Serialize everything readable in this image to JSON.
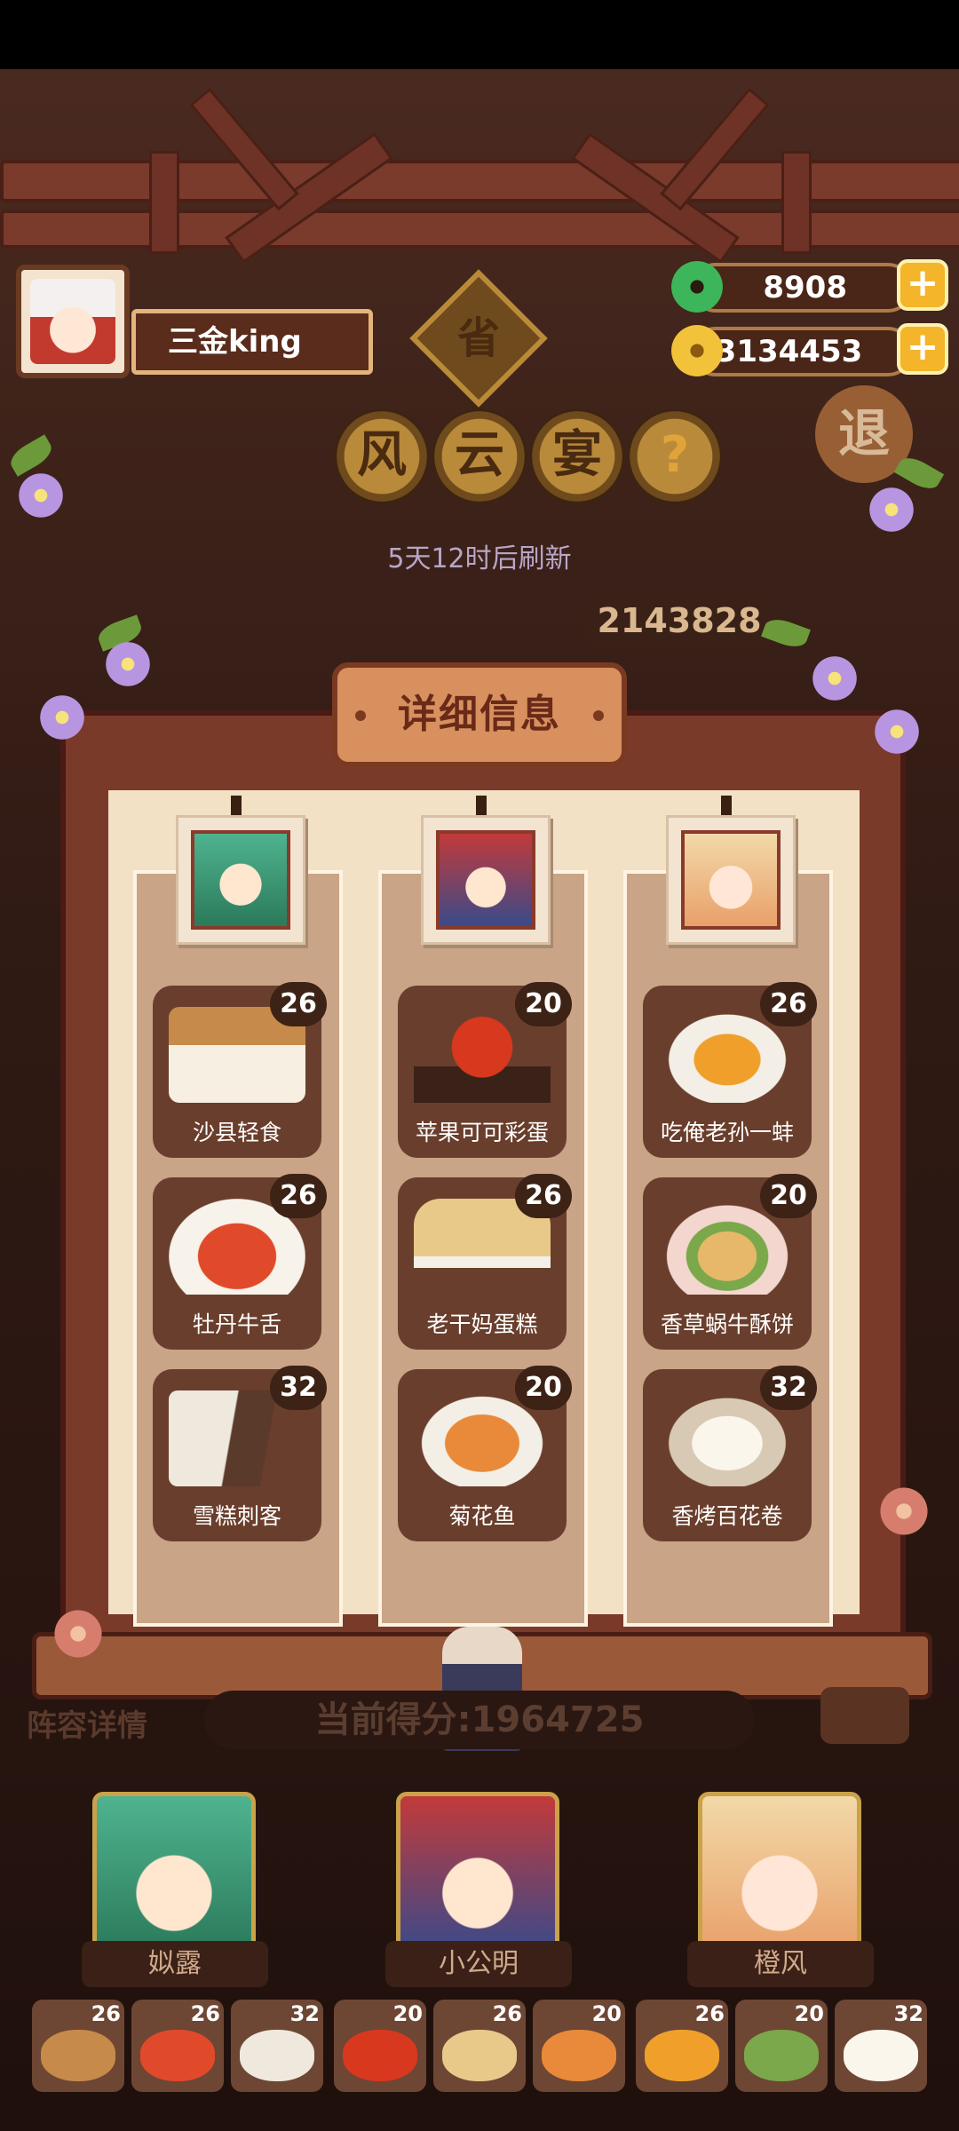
{
  "player": {
    "name": "三金king"
  },
  "currency": {
    "jade": "8908",
    "coins": "33134453"
  },
  "event": {
    "badge": "省",
    "title_chars": [
      "风",
      "云",
      "宴"
    ],
    "help": "?",
    "exit": "退",
    "refresh_text": "5天12时后刷新",
    "score_chip": "2143828"
  },
  "panel": {
    "title": "详细信息",
    "columns": [
      {
        "hero": "姒露",
        "dishes": [
          {
            "name": "沙县轻食",
            "level": "26"
          },
          {
            "name": "牡丹牛舌",
            "level": "26"
          },
          {
            "name": "雪糕刺客",
            "level": "32"
          }
        ]
      },
      {
        "hero": "小公明",
        "dishes": [
          {
            "name": "苹果可可彩蛋",
            "level": "20"
          },
          {
            "name": "老干妈蛋糕",
            "level": "26"
          },
          {
            "name": "菊花鱼",
            "level": "20"
          }
        ]
      },
      {
        "hero": "橙风",
        "dishes": [
          {
            "name": "吃俺老孙一蚌",
            "level": "26"
          },
          {
            "name": "香草蜗牛酥饼",
            "level": "20"
          },
          {
            "name": "香烤百花卷",
            "level": "32"
          }
        ]
      }
    ]
  },
  "bottom": {
    "lineup_label": "阵容详情",
    "current_score": "当前得分:1964725",
    "heroes": [
      "姒露",
      "小公明",
      "橙风"
    ],
    "mini_dishes": [
      "26",
      "26",
      "32",
      "20",
      "26",
      "20",
      "26",
      "20",
      "32"
    ]
  },
  "colors": {
    "accent": "#f4b52a",
    "wood": "#7a3a2a",
    "panel": "#f3e1c6"
  }
}
